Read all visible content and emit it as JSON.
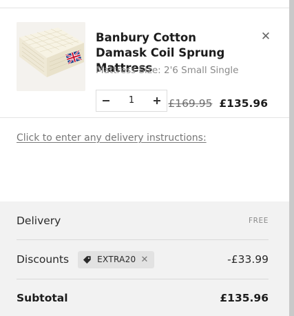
{
  "cart_item": {
    "image_alt": "mattress-product-image",
    "title": "Banbury Cotton Damask Coil Sprung Mattress",
    "variant": "Mattress Size: 2'6 Small Single",
    "remove_icon": "close-icon",
    "quantity": "1",
    "minus_icon": "minus-icon",
    "plus_icon": "plus-icon",
    "price_original": "£169.95",
    "price_sale": "£135.96"
  },
  "delivery_instructions_link": "Click to enter any delivery instructions:",
  "summary": {
    "delivery": {
      "label": "Delivery",
      "value": "FREE"
    },
    "discounts": {
      "label": "Discounts",
      "code_icon": "tag-icon",
      "code": "EXTRA20",
      "code_remove_icon": "close-icon",
      "value": "-£33.99"
    },
    "subtotal": {
      "label": "Subtotal",
      "value": "£135.96"
    }
  },
  "colors": {
    "summary_background": "#f2f2f2",
    "scrollbar": "#c9c9c9",
    "chip_background": "#e2e2e2"
  }
}
